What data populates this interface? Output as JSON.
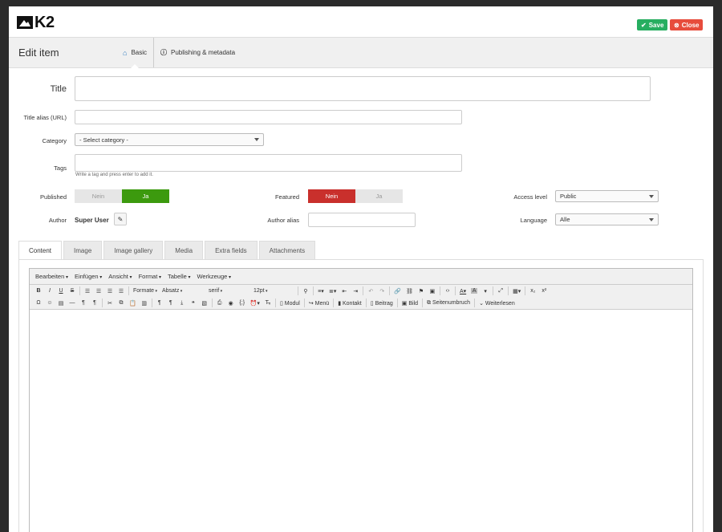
{
  "brand": {
    "logo_text": "K2"
  },
  "actions": {
    "save_label": "Save",
    "close_label": "Close"
  },
  "header": {
    "title": "Edit item",
    "tabs": [
      {
        "label": "Basic"
      },
      {
        "label": "Publishing & metadata"
      }
    ]
  },
  "form": {
    "title_label": "Title",
    "title_value": "",
    "alias_label": "Title alias (URL)",
    "alias_value": "",
    "category_label": "Category",
    "category_value": "- Select category -",
    "tags_label": "Tags",
    "tags_help": "Write a tag and press enter to add it.",
    "published_label": "Published",
    "published_options": [
      "Nein",
      "Ja"
    ],
    "published_value": "Ja",
    "featured_label": "Featured",
    "featured_options": [
      "Nein",
      "Ja"
    ],
    "featured_value": "Nein",
    "access_label": "Access level",
    "access_value": "Public",
    "author_label": "Author",
    "author_value": "Super User",
    "author_alias_label": "Author alias",
    "author_alias_value": "",
    "language_label": "Language",
    "language_value": "Alle"
  },
  "content_tabs": [
    "Content",
    "Image",
    "Image gallery",
    "Media",
    "Extra fields",
    "Attachments"
  ],
  "editor": {
    "menus": [
      "Bearbeiten",
      "Einfügen",
      "Ansicht",
      "Format",
      "Tabelle",
      "Werkzeuge"
    ],
    "formats_label": "Formate",
    "block_label": "Absatz",
    "font_label": "serif",
    "size_label": "12pt",
    "buttons": {
      "modul": "Modul",
      "menu": "Menü",
      "kontakt": "Kontakt",
      "beitrag": "Beitrag",
      "bild": "Bild",
      "seitenumbruch": "Seitenumbruch",
      "weiterlesen": "Weiterlesen"
    }
  },
  "colors": {
    "save": "#27ae60",
    "close": "#e74c3c",
    "published_on": "#3c9a0e",
    "featured_off": "#c9302c",
    "accent": "#2f7bbf"
  }
}
